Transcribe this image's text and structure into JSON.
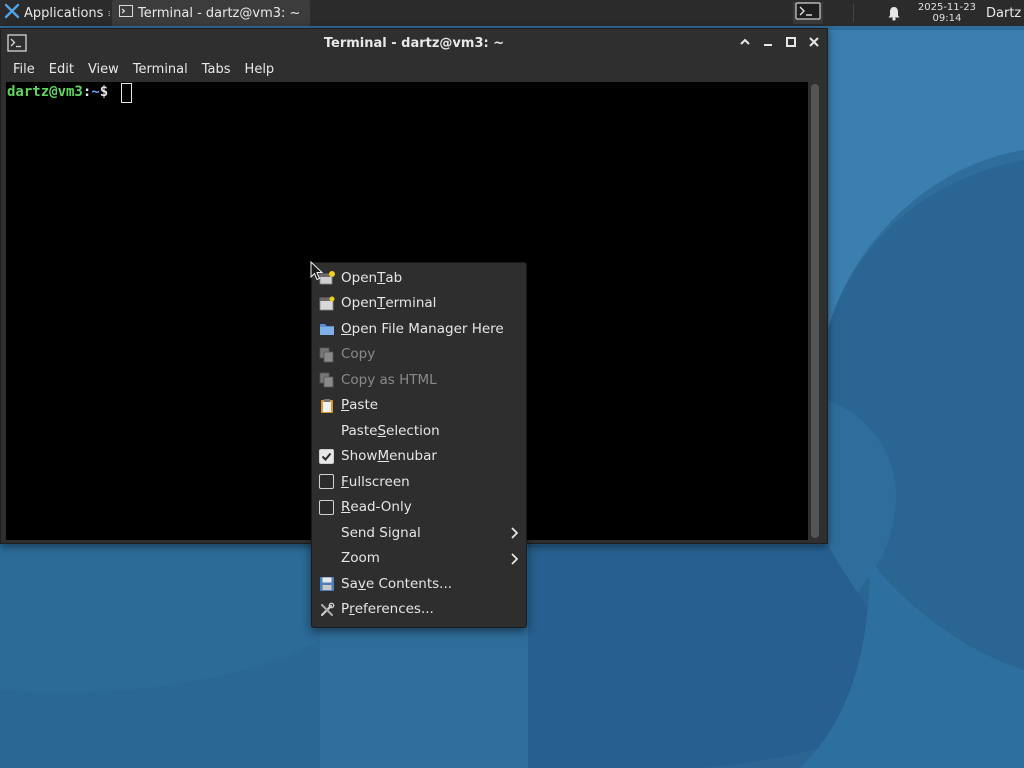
{
  "panel": {
    "applications_label": "Applications",
    "task_label": "Terminal - dartz@vm3: ~",
    "clock_date": "2025-11-23",
    "clock_time": "09:14",
    "user_label": "Dartz",
    "icons": [
      "xfce-logo-icon",
      "terminal-icon",
      "terminal-launcher-icon",
      "bell-icon"
    ]
  },
  "window": {
    "title": "Terminal - dartz@vm3: ~",
    "controls": [
      "shade-icon",
      "minimize-icon",
      "maximize-icon",
      "close-icon"
    ],
    "menu": [
      "File",
      "Edit",
      "View",
      "Terminal",
      "Tabs",
      "Help"
    ]
  },
  "terminal": {
    "prompt_user_host": "dartz@vm3",
    "prompt_colon": ":",
    "prompt_path": "~",
    "prompt_symbol": "$ "
  },
  "context_menu": {
    "open_tab": {
      "pre": "Open ",
      "u": "T",
      "post": "ab"
    },
    "open_terminal": {
      "pre": "Open ",
      "u": "T",
      "post": "erminal"
    },
    "open_file_manager": {
      "pre": "",
      "u": "O",
      "post": "pen File Manager Here"
    },
    "copy": "Copy",
    "copy_html": "Copy as HTML",
    "paste": {
      "pre": "",
      "u": "P",
      "post": "aste"
    },
    "paste_selection": {
      "pre": "Paste ",
      "u": "S",
      "post": "election"
    },
    "show_menubar": {
      "pre": "Show ",
      "u": "M",
      "post": "enubar",
      "checked": true
    },
    "fullscreen": {
      "pre": "",
      "u": "F",
      "post": "ullscreen",
      "checked": false
    },
    "read_only": {
      "pre": "",
      "u": "R",
      "post": "ead-Only",
      "checked": false
    },
    "send_signal": "Send Signal",
    "zoom": "Zoom",
    "save_contents": {
      "pre": "Sa",
      "u": "v",
      "post": "e Contents..."
    },
    "preferences": {
      "pre": "P",
      "u": "r",
      "post": "eferences..."
    }
  },
  "colors": {
    "prompt_user": "#5fd75f",
    "prompt_path": "#6f9fff",
    "desktop": "#2e6e9e",
    "panel": "#2b2b2b"
  }
}
